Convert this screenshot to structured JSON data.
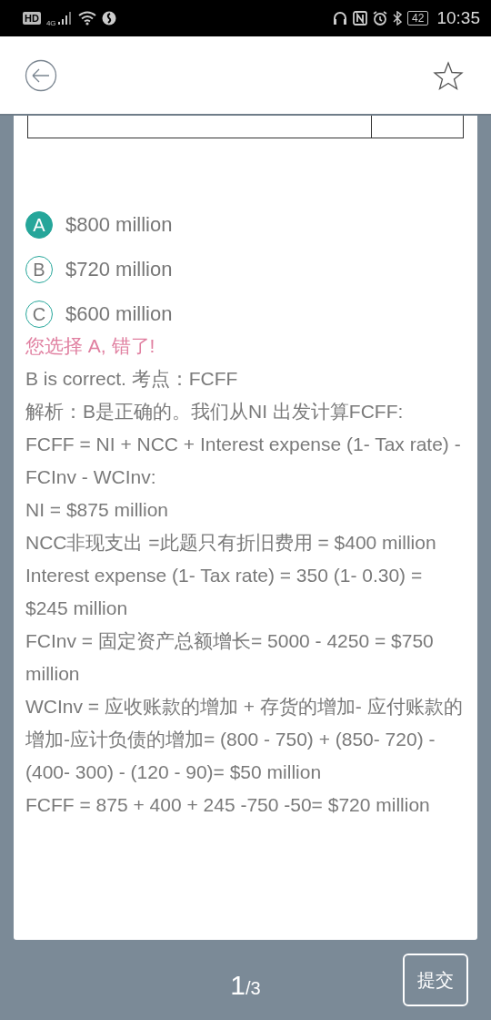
{
  "status_bar": {
    "hd": "HD",
    "network": "4G",
    "battery": "42",
    "time": "10:35"
  },
  "header": {
    "starred": false
  },
  "options": [
    {
      "letter": "A",
      "text": "$800 million",
      "selected": true
    },
    {
      "letter": "B",
      "text": "$720 million",
      "selected": false
    },
    {
      "letter": "C",
      "text": "$600 million",
      "selected": false
    }
  ],
  "result": "您选择 A, 错了!",
  "explanation": [
    "B is correct. 考点：FCFF",
    "解析：B是正确的。我们从NI 出发计算FCFF:",
    "FCFF = NI + NCC + Interest expense (1- Tax rate) - FCInv - WCInv:",
    "NI = $875 million",
    "NCC非现支出 =此题只有折旧费用 = $400 million",
    "Interest expense (1- Tax rate) = 350 (1- 0.30) = $245 million",
    "FCInv = 固定资产总额增长= 5000 - 4250 = $750 million",
    "WCInv = 应收账款的增加 + 存货的增加- 应付账款的增加-应计负债的增加= (800 - 750) + (850- 720) - (400- 300) - (120 - 90)= $50 million",
    "FCFF = 875 + 400 + 245 -750 -50= $720 million"
  ],
  "footer": {
    "current": "1",
    "total": "/3",
    "submit": "提交"
  }
}
